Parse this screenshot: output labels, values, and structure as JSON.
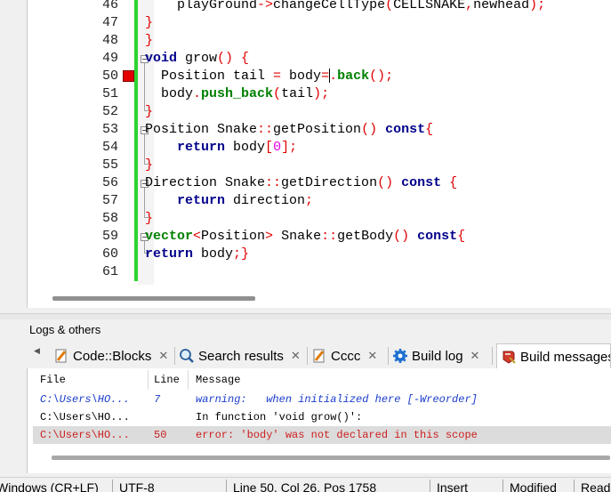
{
  "editor": {
    "lines": [
      {
        "num": "46"
      },
      {
        "num": "47"
      },
      {
        "num": "48"
      },
      {
        "num": "49"
      },
      {
        "num": "50"
      },
      {
        "num": "51"
      },
      {
        "num": "52"
      },
      {
        "num": "53"
      },
      {
        "num": "54"
      },
      {
        "num": "55"
      },
      {
        "num": "56"
      },
      {
        "num": "57"
      },
      {
        "num": "58"
      },
      {
        "num": "59"
      },
      {
        "num": "60"
      },
      {
        "num": "61"
      }
    ],
    "code": {
      "l46_a": "    playGround",
      "l46_b": "->",
      "l46_c": "changeCellType",
      "l46_d": "(",
      "l46_e": "CELLSNAKE",
      "l46_f": ",",
      "l46_g": "newhead",
      "l46_h": ");",
      "l47": "}",
      "l48": "}",
      "l49_kw": "void",
      "l49_rest": " grow",
      "l49_op": "() {",
      "l50_a": "  Position tail ",
      "l50_b": "=",
      "l50_c": " body",
      "l50_d": "=",
      "l50_e": ".",
      "l50_f": "back",
      "l50_g": "();",
      "l51_a": "  body",
      "l51_b": ".",
      "l51_c": "push_back",
      "l51_d": "(",
      "l51_e": "tail",
      "l51_f": ");",
      "l52": "}",
      "l53_a": "Position Snake",
      "l53_b": "::",
      "l53_c": "getPosition",
      "l53_d": "()",
      "l53_e": " ",
      "l53_kw": "const",
      "l53_f": "{",
      "l54_a": "    ",
      "l54_kw": "return",
      "l54_b": " body",
      "l54_c": "[",
      "l54_d": "0",
      "l54_e": "];",
      "l55": "}",
      "l56_a": "Direction Snake",
      "l56_b": "::",
      "l56_c": "getDirection",
      "l56_d": "()",
      "l56_e": " ",
      "l56_kw": "const",
      "l56_f": " {",
      "l57_a": "    ",
      "l57_kw": "return",
      "l57_b": " direction",
      "l57_c": ";",
      "l58": "}",
      "l59_kw": "vector",
      "l59_a": "<",
      "l59_b": "Position",
      "l59_c": ">",
      "l59_d": " Snake",
      "l59_e": "::",
      "l59_f": "getBody",
      "l59_g": "()",
      "l59_h": " ",
      "l59_kw2": "const",
      "l59_i": "{",
      "l60_kw": "return",
      "l60_a": " body",
      "l60_b": ";}",
      "l61": ""
    },
    "colors": {
      "keyword": "#00008b",
      "operator": "#e00000",
      "function": "#008000",
      "number": "#e000e0",
      "changebar": "#2ed42e",
      "breakpoint": "#e30000"
    }
  },
  "logs": {
    "title": "Logs & others",
    "tabs": [
      {
        "label": "Code::Blocks",
        "close": "✕",
        "icon": "page-edit-icon"
      },
      {
        "label": "Search results",
        "close": "✕",
        "icon": "magnifier-icon"
      },
      {
        "label": "Cccc",
        "close": "✕",
        "icon": "page-edit-icon"
      },
      {
        "label": "Build log",
        "close": "✕",
        "icon": "gear-icon"
      },
      {
        "label": "Build messages",
        "icon": "build-messages-icon"
      }
    ],
    "columns": {
      "file": "File",
      "line": "Line",
      "message": "Message"
    },
    "rows": [
      {
        "file": "C:\\Users\\HO...",
        "line": "7",
        "message": "warning:   when initialized here [-Wreorder]",
        "type": "warning"
      },
      {
        "file": "C:\\Users\\HO...",
        "line": "",
        "message": "In function 'void grow()':",
        "type": "info"
      },
      {
        "file": "C:\\Users\\HO...",
        "line": "50",
        "message": "error: 'body' was not declared in this scope",
        "type": "error"
      }
    ]
  },
  "statusbar": {
    "eol": "Windows (CR+LF)",
    "encoding": "UTF-8",
    "position": "Line 50, Col 26, Pos 1758",
    "mode": "Insert",
    "modified": "Modified",
    "access": "Read"
  }
}
